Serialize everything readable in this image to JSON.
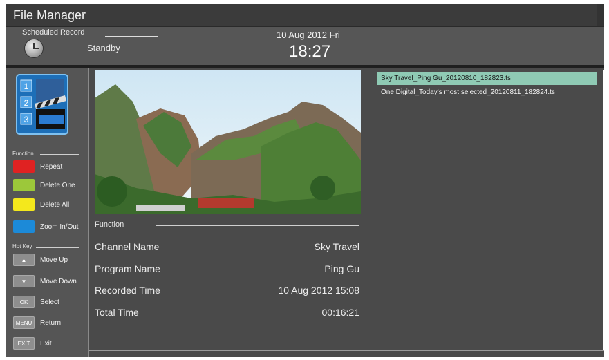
{
  "app": {
    "title": "File Manager"
  },
  "header": {
    "scheduled_label": "Scheduled Record",
    "status": "Standby",
    "date": "10 Aug 2012 Fri",
    "time": "18:27"
  },
  "sidebar": {
    "logo_icon": "videos-clapper-icon",
    "function_label": "Function",
    "function_buttons": [
      {
        "label": "Repeat",
        "color": "#e02222",
        "icon": "red-key"
      },
      {
        "label": "Delete One",
        "color": "#9cc83a",
        "icon": "green-key"
      },
      {
        "label": "Delete All",
        "color": "#f4e81c",
        "icon": "yellow-key"
      },
      {
        "label": "Zoom In/Out",
        "color": "#1c8ad8",
        "icon": "blue-key"
      }
    ],
    "hotkey_label": "Hot Key",
    "hotkeys": [
      {
        "key": "▲",
        "label": "Move Up",
        "icon": "up-arrow-icon"
      },
      {
        "key": "▼",
        "label": "Move Down",
        "icon": "down-arrow-icon"
      },
      {
        "key": "OK",
        "label": "Select"
      },
      {
        "key": "MENU",
        "label": "Return"
      },
      {
        "key": "EXIT",
        "label": "Exit"
      }
    ]
  },
  "details": {
    "function_label": "Function",
    "rows": [
      {
        "key": "Channel Name",
        "value": "Sky Travel"
      },
      {
        "key": "Program Name",
        "value": "Ping Gu"
      },
      {
        "key": "Recorded Time",
        "value": "10 Aug 2012 15:08"
      },
      {
        "key": "Total Time",
        "value": "00:16:21"
      }
    ]
  },
  "files": [
    {
      "name": "Sky Travel_Ping Gu_20120810_182823.ts",
      "selected": true
    },
    {
      "name": "One Digital_Today's most selected_20120811_182824.ts",
      "selected": false
    }
  ]
}
